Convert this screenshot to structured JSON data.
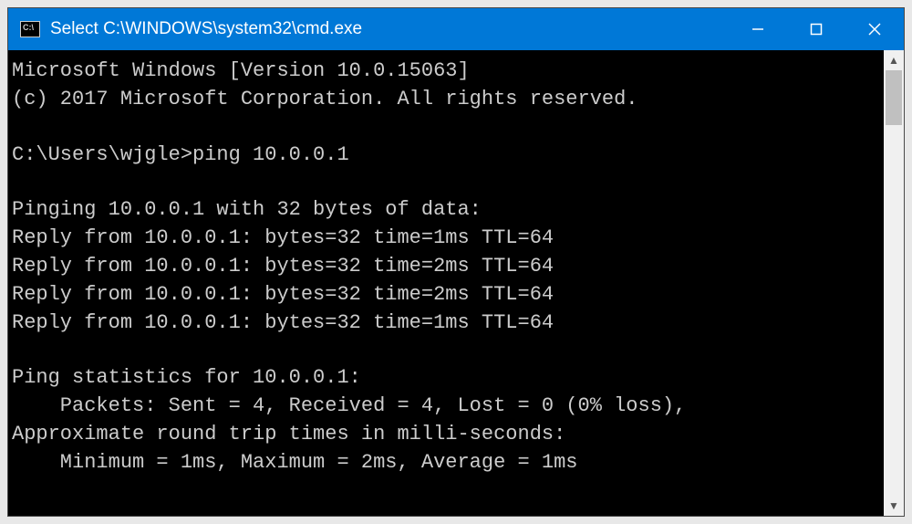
{
  "titlebar": {
    "icon_glyph": "C:\\",
    "title": "Select C:\\WINDOWS\\system32\\cmd.exe"
  },
  "terminal": {
    "lines": [
      "Microsoft Windows [Version 10.0.15063]",
      "(c) 2017 Microsoft Corporation. All rights reserved.",
      "",
      "C:\\Users\\wjgle>ping 10.0.0.1",
      "",
      "Pinging 10.0.0.1 with 32 bytes of data:",
      "Reply from 10.0.0.1: bytes=32 time=1ms TTL=64",
      "Reply from 10.0.0.1: bytes=32 time=2ms TTL=64",
      "Reply from 10.0.0.1: bytes=32 time=2ms TTL=64",
      "Reply from 10.0.0.1: bytes=32 time=1ms TTL=64",
      "",
      "Ping statistics for 10.0.0.1:",
      "    Packets: Sent = 4, Received = 4, Lost = 0 (0% loss),",
      "Approximate round trip times in milli-seconds:",
      "    Minimum = 1ms, Maximum = 2ms, Average = 1ms"
    ]
  }
}
